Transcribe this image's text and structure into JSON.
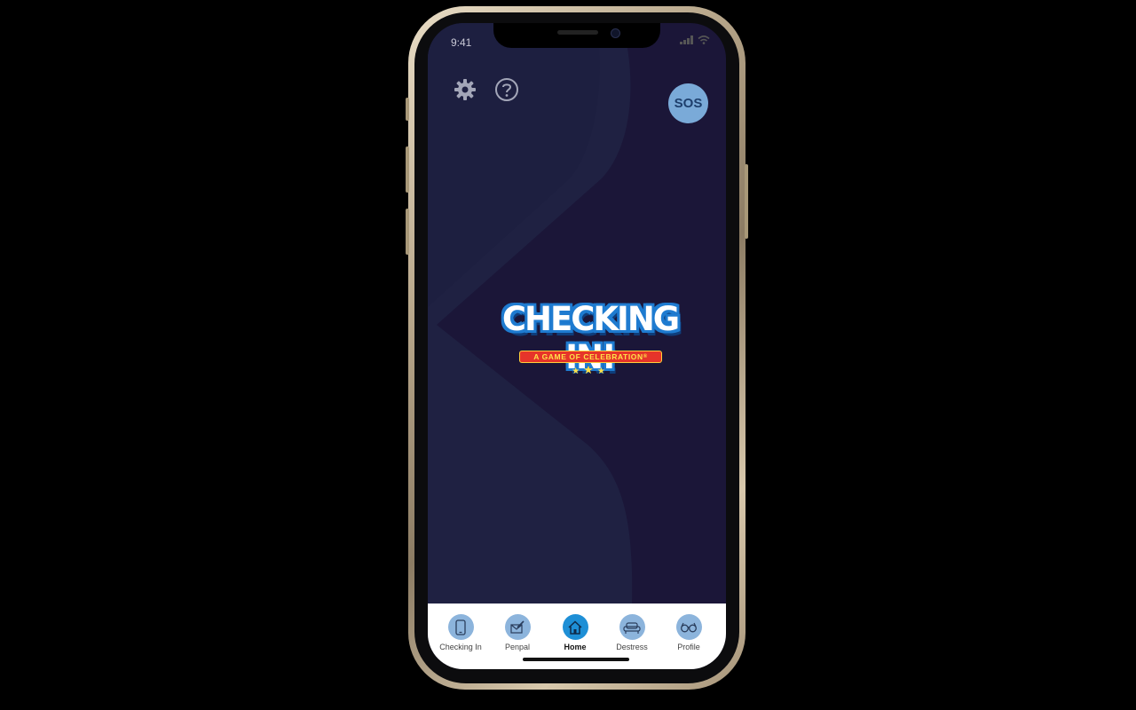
{
  "status_bar": {
    "time": "9:41"
  },
  "header": {
    "sos_label": "SOS",
    "settings_icon": "gear-icon",
    "help_icon": "question-circle-icon"
  },
  "logo": {
    "title": "CHECKING IN!",
    "tagline": "A GAME OF CELEBRATION",
    "trademark": "®"
  },
  "colors": {
    "background": "#1b1638",
    "accent": "#1e8fd6",
    "tab_circle": "#8cb4dc",
    "sos": "#7aaad8"
  },
  "tabbar": {
    "tabs": [
      {
        "label": "Checking In",
        "icon": "phone-icon",
        "active": false
      },
      {
        "label": "Penpal",
        "icon": "letter-pen-icon",
        "active": false
      },
      {
        "label": "Home",
        "icon": "home-icon",
        "active": true
      },
      {
        "label": "Destress",
        "icon": "couch-icon",
        "active": false
      },
      {
        "label": "Profile",
        "icon": "glasses-icon",
        "active": false
      }
    ]
  }
}
